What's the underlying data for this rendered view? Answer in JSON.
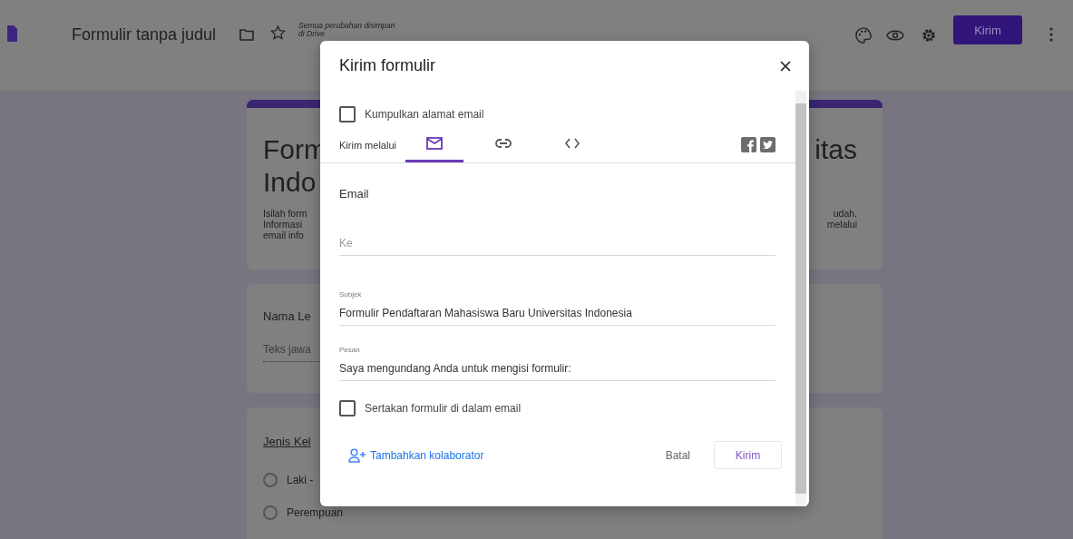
{
  "top_bar": {
    "title": "Formulir tanpa judul",
    "save_status": "Semua perubahan disimpan di Drive",
    "send_button": "Kirim"
  },
  "background_form": {
    "title_left": "Form",
    "title_right": "itas",
    "title_line2": "Indo",
    "description": [
      {
        "left": "Isilah form",
        "right": "udah."
      },
      {
        "left": "Informasi",
        "right": "melalui"
      },
      {
        "left": "email info"
      }
    ],
    "name_question": {
      "label": "Nama Le",
      "placeholder": "Teks jawa"
    },
    "gender_question": {
      "label": "Jenis Kel",
      "options": [
        {
          "label": "Laki -",
          "selected": false
        },
        {
          "label": "Perempuan",
          "selected": false
        }
      ]
    }
  },
  "dialog": {
    "title": "Kirim formulir",
    "collect_email": {
      "label": "Kumpulkan alamat email",
      "checked": false
    },
    "send_via_label": "Kirim melalui",
    "tabs": [
      {
        "kind": "email",
        "selected": true
      },
      {
        "kind": "link",
        "selected": false
      },
      {
        "kind": "embed",
        "selected": false
      }
    ],
    "section_title": "Email",
    "to": {
      "placeholder": "Ke"
    },
    "subject": {
      "label": "Subjek",
      "value": "Formulir Pendaftaran Mahasiswa Baru Universitas Indonesia"
    },
    "message": {
      "label": "Pesan",
      "value": "Saya mengundang Anda untuk mengisi formulir:"
    },
    "include_form": {
      "label": "Sertakan formulir di dalam email",
      "checked": false
    },
    "add_collaborators": "Tambahkan kolaborator",
    "cancel": "Batal",
    "send": "Kirim"
  }
}
